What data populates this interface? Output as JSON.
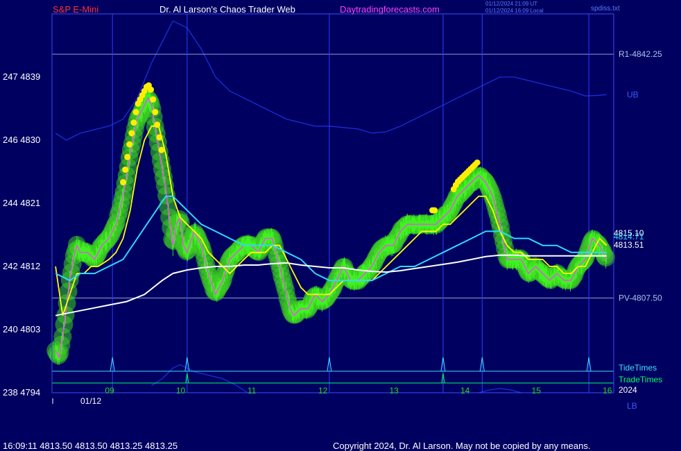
{
  "header": {
    "symbol": "S&P E-Mini",
    "site_title": "Dr. Al Larson's Chaos Trader Web",
    "site_url": "Daytradingforecasts.com",
    "time_utc": "01/12/2024 21:09 UT",
    "time_local": "01/12/2024 16:09 Local",
    "file": "spdiss.txt"
  },
  "footer": {
    "quote": "16:09:11  4813.50 4813.50 4813.25 4813.25",
    "copyright": "Copyright 2024, Dr. Al Larson. May not be copied by any means."
  },
  "colors": {
    "background": "#000060",
    "frame": "#3a4cff",
    "price_bars": "#3ccc22",
    "fast_average": "#ffff00",
    "slow_average": "#30d8ff",
    "long_average": "#ffffff",
    "band": "#1a2ed8",
    "tide_line": "#40e0ff",
    "trade_line": "#00ff66",
    "spiral": "#ff40ff",
    "x_labels": "#20dd20",
    "right_labels": "#a8c4e8"
  },
  "chart_data": {
    "type": "line",
    "title": "S&P E-Mini",
    "y_ticks": [
      {
        "label": "247  4839",
        "value": 4839
      },
      {
        "label": "246  4830",
        "value": 4830
      },
      {
        "label": "244  4821",
        "value": 4821
      },
      {
        "label": "242  4812",
        "value": 4812
      },
      {
        "label": "240  4803",
        "value": 4803
      },
      {
        "label": "238  4794",
        "value": 4794
      }
    ],
    "ylim": [
      4794,
      4848
    ],
    "x_ticks": [
      {
        "label": "09",
        "value": 9.0
      },
      {
        "label": "10",
        "value": 10.0
      },
      {
        "label": "11",
        "value": 11.0
      },
      {
        "label": "12",
        "value": 12.0
      },
      {
        "label": "13",
        "value": 13.0
      },
      {
        "label": "14",
        "value": 14.0
      },
      {
        "label": "15",
        "value": 15.0
      },
      {
        "label": "16",
        "value": 16.0
      }
    ],
    "x_date_label": "01/12",
    "x_year_label": "2024",
    "xlim": [
      8.2,
      16.1
    ],
    "levels": [
      {
        "label": "R1-4842.25",
        "value": 4842.25
      },
      {
        "label": "PV-4807.50",
        "value": 4807.5
      }
    ],
    "band_labels": {
      "upper": "UB",
      "lower": "LB"
    },
    "last_values": [
      {
        "label": "4815.10",
        "value": 4815.1,
        "series": "fast"
      },
      {
        "label": "4814.71",
        "value": 4814.71,
        "series": "slow"
      },
      {
        "label": "4813.51",
        "value": 4813.51,
        "series": "long"
      }
    ],
    "timing_lines": [
      {
        "label": "TideTimes",
        "times": [
          9.05,
          10.1,
          12.1,
          13.7,
          14.25,
          15.75
        ]
      },
      {
        "label": "TradeTimes",
        "times": [
          10.1,
          13.7
        ]
      }
    ],
    "price": {
      "x": [
        8.25,
        8.3,
        8.35,
        8.4,
        8.45,
        8.5,
        8.55,
        8.6,
        8.7,
        8.8,
        8.9,
        9.0,
        9.1,
        9.2,
        9.3,
        9.4,
        9.5,
        9.55,
        9.6,
        9.7,
        9.8,
        9.9,
        9.95,
        10.0,
        10.05,
        10.1,
        10.2,
        10.3,
        10.4,
        10.5,
        10.6,
        10.7,
        10.8,
        10.9,
        11.0,
        11.1,
        11.2,
        11.3,
        11.4,
        11.5,
        11.55,
        11.6,
        11.7,
        11.8,
        11.9,
        12.0,
        12.1,
        12.2,
        12.3,
        12.4,
        12.5,
        12.6,
        12.7,
        12.8,
        12.9,
        13.0,
        13.1,
        13.2,
        13.3,
        13.4,
        13.5,
        13.6,
        13.7,
        13.8,
        13.9,
        14.0,
        14.1,
        14.2,
        14.3,
        14.4,
        14.5,
        14.6,
        14.7,
        14.8,
        14.9,
        15.0,
        15.1,
        15.2,
        15.3,
        15.4,
        15.5,
        15.6,
        15.7,
        15.8,
        15.9,
        16.0
      ],
      "y": [
        4800,
        4799,
        4802,
        4806,
        4810,
        4813,
        4815,
        4814,
        4814,
        4813,
        4815,
        4816,
        4818,
        4822,
        4828,
        4833,
        4835,
        4836,
        4835,
        4829,
        4823,
        4815,
        4818,
        4819,
        4815,
        4814,
        4817,
        4815,
        4811,
        4808,
        4810,
        4813,
        4814,
        4815,
        4815,
        4814,
        4816,
        4816,
        4812,
        4808,
        4806,
        4805,
        4806,
        4806,
        4808,
        4807,
        4808,
        4810,
        4812,
        4810,
        4810,
        4811,
        4812,
        4814,
        4815,
        4815,
        4817,
        4818,
        4818,
        4818,
        4818,
        4818,
        4819,
        4820,
        4822,
        4823,
        4824,
        4825,
        4824,
        4822,
        4818,
        4813,
        4813,
        4813,
        4811,
        4812,
        4811,
        4810,
        4811,
        4810,
        4810,
        4812,
        4813,
        4816,
        4815,
        4813
      ]
    },
    "series": [
      {
        "name": "fast",
        "x": [
          8.25,
          8.35,
          8.45,
          8.55,
          8.65,
          8.75,
          8.85,
          9.0,
          9.1,
          9.2,
          9.3,
          9.4,
          9.5,
          9.6,
          9.7,
          9.8,
          9.9,
          10.0,
          10.1,
          10.2,
          10.3,
          10.4,
          10.5,
          10.6,
          10.7,
          10.8,
          10.9,
          11.0,
          11.1,
          11.2,
          11.3,
          11.4,
          11.5,
          11.6,
          11.7,
          11.8,
          11.9,
          12.0,
          12.1,
          12.2,
          12.3,
          12.4,
          12.5,
          12.6,
          12.7,
          12.8,
          12.9,
          13.0,
          13.1,
          13.2,
          13.3,
          13.4,
          13.5,
          13.6,
          13.7,
          13.8,
          13.9,
          14.0,
          14.1,
          14.2,
          14.3,
          14.4,
          14.5,
          14.6,
          14.7,
          14.8,
          14.9,
          15.0,
          15.1,
          15.2,
          15.3,
          15.4,
          15.5,
          15.6,
          15.7,
          15.8,
          15.9,
          16.0
        ],
        "y": [
          4812,
          4805,
          4808,
          4811,
          4811,
          4812,
          4812,
          4813,
          4814,
          4816,
          4820,
          4826,
          4830,
          4832,
          4832,
          4828,
          4822,
          4819,
          4818,
          4817,
          4816,
          4814,
          4813,
          4812,
          4811,
          4812,
          4813,
          4814,
          4814,
          4814,
          4815,
          4815,
          4813,
          4811,
          4809,
          4808,
          4808,
          4808,
          4808,
          4809,
          4810,
          4810,
          4810,
          4810,
          4810,
          4811,
          4812,
          4813,
          4814,
          4815,
          4816,
          4817,
          4817,
          4817,
          4818,
          4818,
          4819,
          4820,
          4821,
          4822,
          4822,
          4820,
          4817,
          4815,
          4814,
          4814,
          4813,
          4813,
          4813,
          4812,
          4812,
          4811,
          4811,
          4812,
          4812,
          4814,
          4816,
          4815
        ]
      },
      {
        "name": "slow",
        "x": [
          8.25,
          8.45,
          8.6,
          8.8,
          9.0,
          9.2,
          9.4,
          9.6,
          9.8,
          9.9,
          10.0,
          10.1,
          10.2,
          10.3,
          10.5,
          10.7,
          10.9,
          11.1,
          11.3,
          11.5,
          11.7,
          11.9,
          12.1,
          12.3,
          12.5,
          12.7,
          12.9,
          13.1,
          13.3,
          13.5,
          13.7,
          13.9,
          14.1,
          14.3,
          14.5,
          14.7,
          14.9,
          15.1,
          15.3,
          15.5,
          15.7,
          15.9,
          16.0
        ],
        "y": [
          4811,
          4810,
          4811,
          4811,
          4812,
          4813,
          4816,
          4819,
          4822,
          4822,
          4821,
          4820,
          4819,
          4818,
          4817,
          4816,
          4815,
          4815,
          4815,
          4814,
          4813,
          4811,
          4810,
          4810,
          4810,
          4810,
          4811,
          4812,
          4812,
          4813,
          4814,
          4815,
          4816,
          4817,
          4817,
          4816,
          4816,
          4815,
          4815,
          4814,
          4814,
          4814,
          4814
        ]
      },
      {
        "name": "long",
        "x": [
          8.25,
          8.5,
          8.75,
          9.0,
          9.25,
          9.5,
          9.75,
          9.9,
          10.1,
          10.3,
          10.5,
          10.7,
          10.9,
          11.1,
          11.3,
          11.5,
          11.7,
          11.9,
          12.1,
          12.3,
          12.5,
          12.7,
          12.9,
          13.1,
          13.3,
          13.5,
          13.7,
          13.9,
          14.1,
          14.3,
          14.5,
          14.7,
          14.9,
          15.1,
          15.3,
          15.5,
          15.7,
          15.9,
          16.0
        ],
        "y": [
          4805,
          4805.5,
          4806,
          4806.5,
          4807,
          4808,
          4810,
          4811,
          4811.5,
          4811.8,
          4812,
          4812,
          4812.2,
          4812.2,
          4812.4,
          4812.5,
          4812.2,
          4812,
          4811.8,
          4811.8,
          4811.5,
          4811.3,
          4811.2,
          4811.4,
          4811.7,
          4812,
          4812.3,
          4812.6,
          4813,
          4813.4,
          4813.6,
          4813.6,
          4813.5,
          4813.5,
          4813.5,
          4813.5,
          4813.5,
          4813.5,
          4813.5
        ]
      }
    ],
    "upper_band": {
      "x": [
        8.25,
        8.4,
        8.6,
        8.8,
        9.0,
        9.2,
        9.4,
        9.6,
        9.8,
        9.9,
        10.0,
        10.1,
        10.3,
        10.5,
        10.7,
        10.9,
        11.1,
        11.3,
        11.5,
        11.7,
        11.9,
        12.1,
        12.3,
        12.5,
        12.7,
        12.9,
        13.1,
        13.3,
        13.5,
        13.7,
        13.9,
        14.1,
        14.3,
        14.5,
        14.7,
        14.9,
        15.1,
        15.3,
        15.5,
        15.7,
        15.9,
        16.0
      ],
      "y": [
        4831,
        4830,
        4831,
        4831.5,
        4832,
        4833,
        4836,
        4841,
        4845,
        4847,
        4846.5,
        4846,
        4843,
        4839,
        4837,
        4836,
        4835,
        4834,
        4833,
        4832.5,
        4832,
        4832,
        4831.8,
        4831.6,
        4831,
        4831.2,
        4832,
        4833,
        4834,
        4835,
        4836,
        4837,
        4838,
        4839,
        4839,
        4838.5,
        4838,
        4837.5,
        4837,
        4836.3,
        4836.4,
        4836.5
      ]
    },
    "lower_band": {
      "x": [
        9.6,
        9.75,
        9.9,
        10.0,
        10.1,
        10.2,
        10.4,
        10.6,
        10.8,
        10.95
      ],
      "y": [
        4795,
        4796,
        4797.5,
        4798,
        4797.5,
        4797,
        4796.5,
        4796,
        4795,
        4794
      ]
    },
    "lower_band_2": {
      "x": [
        14.2,
        14.35,
        14.5,
        14.65,
        14.8
      ],
      "y": [
        4794,
        4794.4,
        4794.6,
        4794.4,
        4794
      ]
    }
  }
}
